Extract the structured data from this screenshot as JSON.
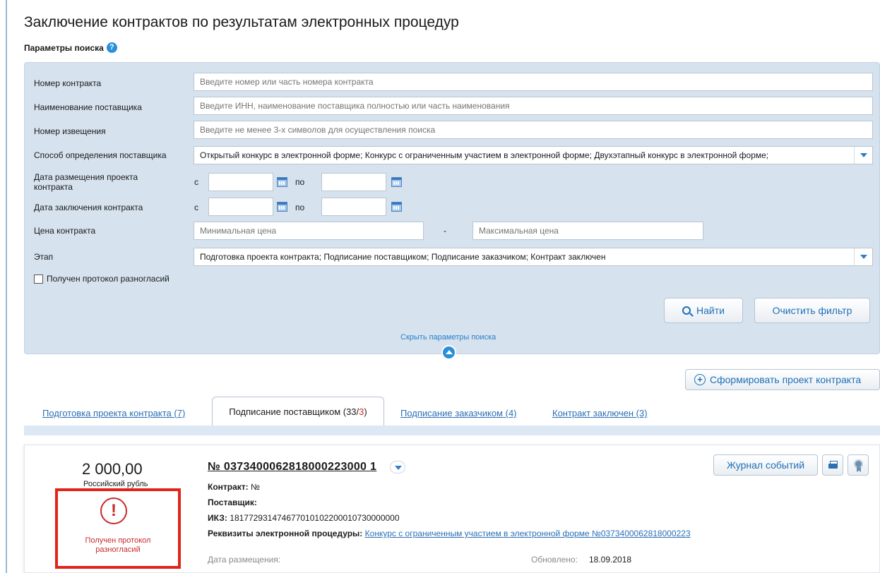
{
  "page": {
    "title": "Заключение контрактов по результатам электронных процедур",
    "params_heading": "Параметры поиска",
    "help_glyph": "?"
  },
  "search": {
    "contract_number": {
      "label": "Номер контракта",
      "placeholder": "Введите номер или часть номера контракта"
    },
    "supplier_name": {
      "label": "Наименование поставщика",
      "placeholder": "Введите ИНН, наименование поставщика полностью или часть наименования"
    },
    "notice_number": {
      "label": "Номер извещения",
      "placeholder": "Введите не менее 3-х символов для осуществления поиска"
    },
    "supplier_method": {
      "label": "Способ определения поставщика",
      "value": "Открытый конкурс в электронной форме; Конкурс с ограниченным участием в электронной форме; Двухэтапный конкурс в электронной форме;"
    },
    "draft_date": {
      "label": "Дата размещения проекта контракта",
      "from_label": "с",
      "to_label": "по"
    },
    "conclusion_date": {
      "label": "Дата заключения контракта",
      "from_label": "с",
      "to_label": "по"
    },
    "price": {
      "label": "Цена контракта",
      "min_placeholder": "Минимальная цена",
      "separator": "-",
      "max_placeholder": "Максимальная цена"
    },
    "stage": {
      "label": "Этап",
      "value": "Подготовка проекта контракта; Подписание поставщиком; Подписание заказчиком; Контракт заключен"
    },
    "disagreement_checkbox_label": "Получен протокол разногласий",
    "find_button": "Найти",
    "clear_button": "Очистить фильтр",
    "hide_link": "Скрыть параметры поиска"
  },
  "actions": {
    "form_draft_button": "Сформировать проект контракта"
  },
  "tabs": [
    {
      "label": "Подготовка проекта контракта (7)",
      "active": false
    },
    {
      "label": "Подписание поставщиком (33/",
      "count_highlight": "3",
      "suffix": ")",
      "active": true
    },
    {
      "label": "Подписание заказчиком (4)",
      "active": false
    },
    {
      "label": "Контракт заключен (3)",
      "active": false
    }
  ],
  "card": {
    "price": "2 000,00",
    "currency": "Российский рубль",
    "warning_glyph": "!",
    "warning_text": "Получен протокол разногласий",
    "contract_number": "№ 0373400062818000223000 1",
    "contract_label": "Контракт:",
    "contract_value": "№",
    "supplier_label": "Поставщик:",
    "supplier_value": "",
    "ikz_label": "ИКЗ:",
    "ikz_value": "181772931474677010102200010730000000",
    "procedure_label": "Реквизиты электронной процедуры:",
    "procedure_link": "Конкурс с ограниченным участием в электронной форме №0373400062818000223",
    "placement_date_label": "Дата размещения:",
    "updated_label": "Обновлено:",
    "updated_value": "18.09.2018",
    "journal_button": "Журнал событий"
  },
  "colors": {
    "accent": "#2a8fd8",
    "link": "#2a6fb5",
    "panel": "#d6e2ee",
    "warning": "#e2231a"
  }
}
